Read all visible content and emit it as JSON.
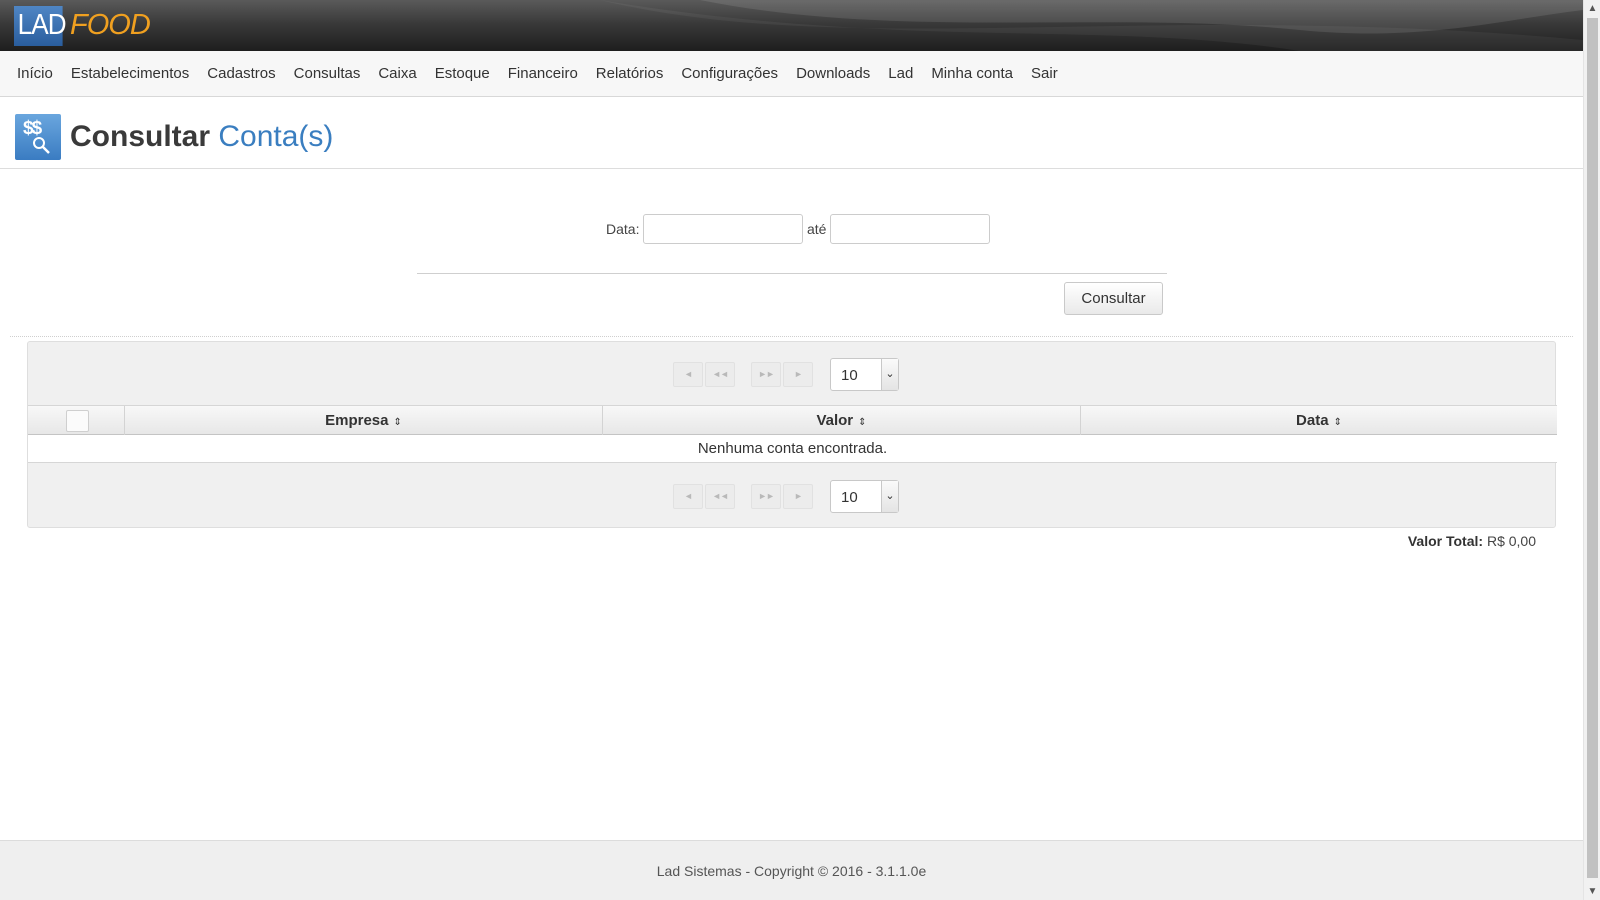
{
  "brand": {
    "part1": "LAD",
    "part2": "FOOD"
  },
  "nav": [
    "Início",
    "Estabelecimentos",
    "Cadastros",
    "Consultas",
    "Caixa",
    "Estoque",
    "Financeiro",
    "Relatórios",
    "Configurações",
    "Downloads",
    "Lad",
    "Minha conta",
    "Sair"
  ],
  "page": {
    "title_main": "Consultar",
    "title_accent": "Conta(s)",
    "icon_glyph": "$$",
    "icon": "money-search-icon"
  },
  "filter": {
    "label_data": "Data:",
    "label_ate": "até",
    "date_from": "",
    "date_to": "",
    "submit": "Consultar"
  },
  "pager": {
    "first": "◄",
    "prev": "◄◄",
    "next": "►►",
    "last": "►",
    "rows_per_page": "10",
    "dropdown_glyph": "⌄"
  },
  "table": {
    "columns": [
      {
        "label": "Empresa",
        "sort": "⇕"
      },
      {
        "label": "Valor",
        "sort": "⇕"
      },
      {
        "label": "Data",
        "sort": "⇕"
      }
    ],
    "empty_message": "Nenhuma conta encontrada."
  },
  "summary": {
    "label": "Valor Total:",
    "value": "R$ 0,00"
  },
  "footer": {
    "text": "Lad Sistemas - Copyright © 2016 - 3.1.1.0e"
  },
  "colors": {
    "brand_blue": "#3a7ec0",
    "brand_orange": "#f0a020",
    "header_dark": "#2a2a2a"
  }
}
